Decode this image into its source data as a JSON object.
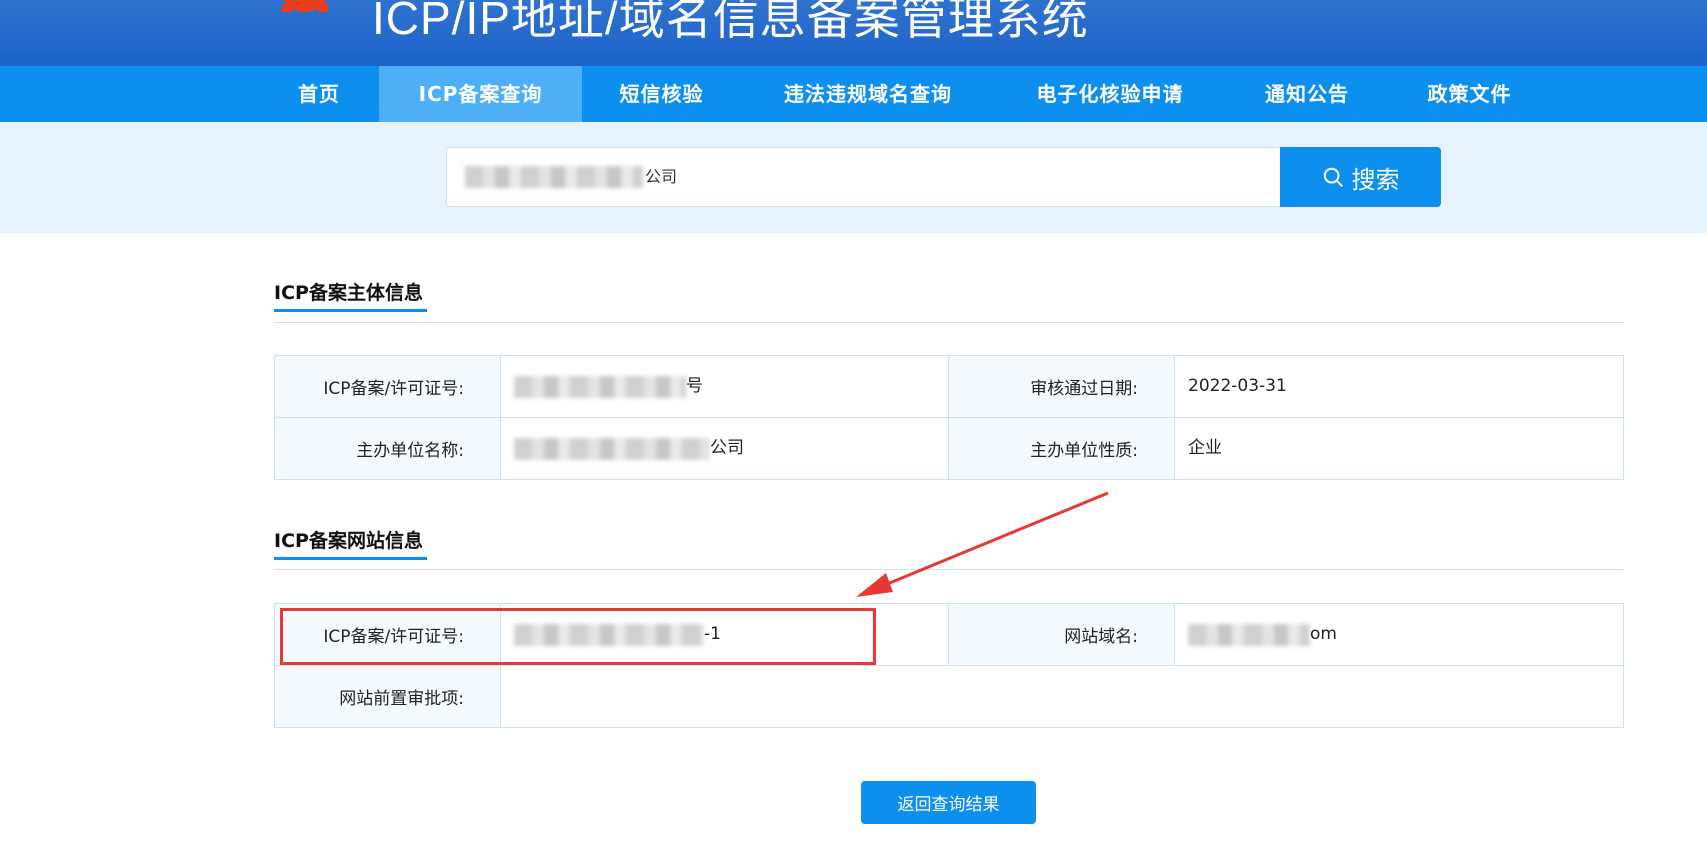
{
  "header": {
    "title": "ICP/IP地址/域名信息备案管理系统"
  },
  "nav": {
    "items": [
      {
        "label": "首页"
      },
      {
        "label": "ICP备案查询"
      },
      {
        "label": "短信核验"
      },
      {
        "label": "违法违规域名查询"
      },
      {
        "label": "电子化核验申请"
      },
      {
        "label": "通知公告"
      },
      {
        "label": "政策文件"
      }
    ],
    "active_index": 1
  },
  "search": {
    "value_visible_suffix": "公司",
    "button_label": "搜索"
  },
  "subject_section": {
    "title": "ICP备案主体信息",
    "rows": [
      {
        "label1": "ICP备案/许可证号:",
        "value1": "号",
        "label2": "审核通过日期:",
        "value2": "2022-03-31"
      },
      {
        "label1": "主办单位名称:",
        "value1": "公司",
        "label2": "主办单位性质:",
        "value2": "企业"
      }
    ]
  },
  "website_section": {
    "title": "ICP备案网站信息",
    "row1": {
      "label1": "ICP备案/许可证号:",
      "value1": "-1",
      "label2": "网站域名:",
      "value2": "om"
    },
    "row2": {
      "label": "网站前置审批项:",
      "value": ""
    }
  },
  "footer": {
    "return_label": "返回查询结果"
  },
  "colors": {
    "brand_blue": "#0d8ff0",
    "header_blue": "#2f72cf",
    "annotation_red": "#e53935"
  }
}
